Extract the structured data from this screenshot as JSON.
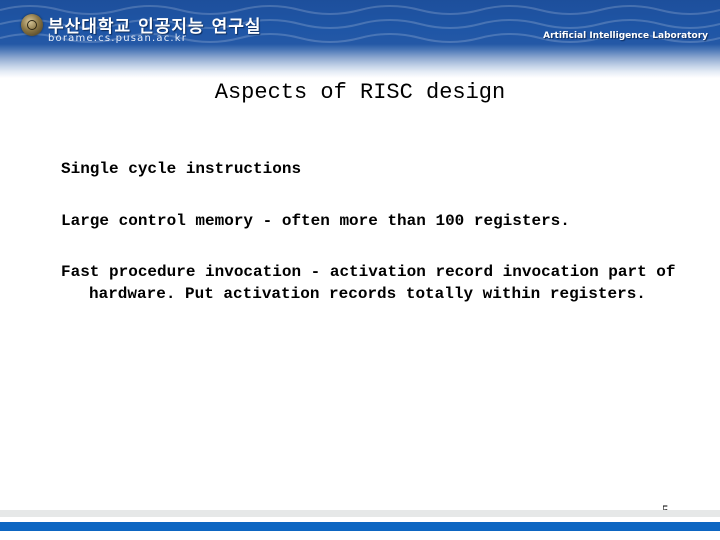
{
  "header": {
    "institution_korean": "부산대학교 인공지능 연구실",
    "url": "borame.cs.pusan.ac.kr",
    "lab_name": "Artificial Intelligence Laboratory",
    "logo_icon": "university-seal-icon",
    "colors": {
      "band": "#1f56a6",
      "text": "#ffffff"
    }
  },
  "slide": {
    "title": "Aspects of RISC design",
    "bullets": [
      "Single cycle instructions",
      "Large control memory - often more than 100 registers.",
      "Fast procedure invocation - activation record invocation part of hardware. Put activation records totally within registers."
    ],
    "page_number": "5"
  },
  "footer": {
    "colors": {
      "gray_stripe": "#e6e8e8",
      "blue_stripe": "#0d66c2"
    }
  }
}
